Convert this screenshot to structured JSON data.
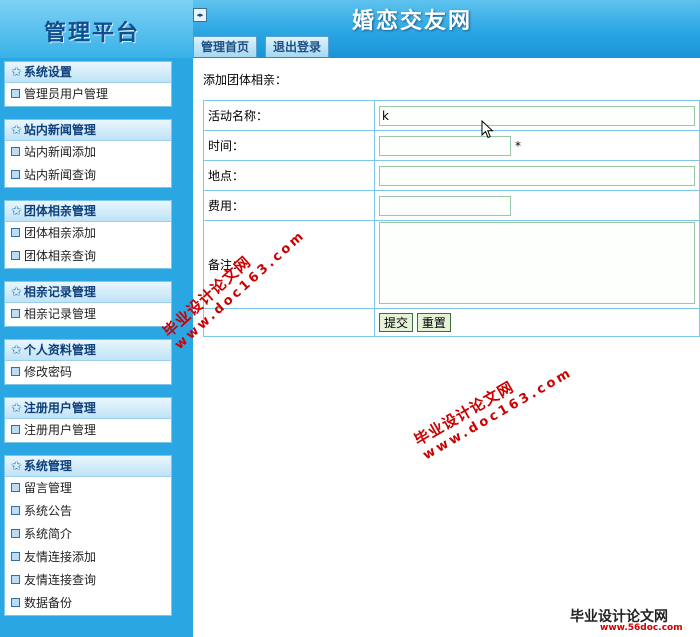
{
  "header": {
    "platform_title": "管理平台",
    "site_title": "婚恋交友网",
    "toggle_icon": "◂▸",
    "tabs": [
      {
        "label": "管理首页"
      },
      {
        "label": "退出登录"
      }
    ]
  },
  "sidebar": {
    "groups": [
      {
        "title": "系统设置",
        "items": [
          "管理员用户管理"
        ]
      },
      {
        "title": "站内新闻管理",
        "items": [
          "站内新闻添加",
          "站内新闻查询"
        ]
      },
      {
        "title": "团体相亲管理",
        "items": [
          "团体相亲添加",
          "团体相亲查询"
        ]
      },
      {
        "title": "相亲记录管理",
        "items": [
          "相亲记录管理"
        ]
      },
      {
        "title": "个人资料管理",
        "items": [
          "修改密码"
        ]
      },
      {
        "title": "注册用户管理",
        "items": [
          "注册用户管理"
        ]
      },
      {
        "title": "系统管理",
        "items": [
          "留言管理",
          "系统公告",
          "系统简介",
          "友情连接添加",
          "友情连接查询",
          "数据备份"
        ]
      }
    ]
  },
  "form": {
    "title": "添加团体相亲：",
    "fields": {
      "name": {
        "label": "活动名称：",
        "value": "k"
      },
      "time": {
        "label": "时间：",
        "value": "",
        "required_mark": "*"
      },
      "place": {
        "label": "地点：",
        "value": ""
      },
      "fee": {
        "label": "费用：",
        "value": ""
      },
      "remark": {
        "label": "备注：",
        "value": ""
      }
    },
    "submit_label": "提交",
    "reset_label": "重置"
  },
  "watermarks": {
    "domain": "www.doc163.com",
    "slogan": "毕业设计论文网",
    "brand": "毕业设计论文网",
    "brand_url": "www.56doc.com"
  },
  "colors": {
    "header_blue": "#2aa6e3",
    "watermark_red": "#cc0000",
    "table_border": "#7dc8e8"
  }
}
